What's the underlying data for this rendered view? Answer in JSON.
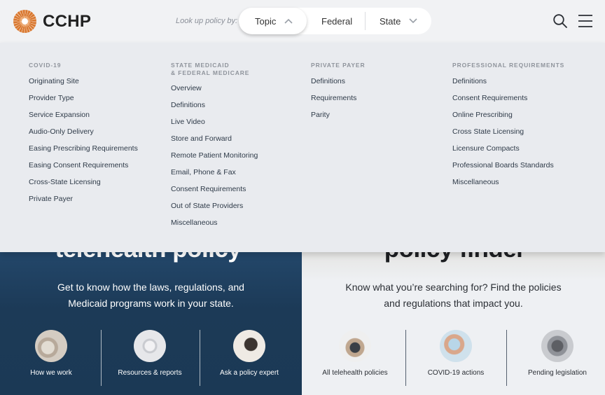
{
  "header": {
    "logo_text": "CCHP",
    "lookup_label": "Look up policy by:",
    "toggle": {
      "topic": "Topic",
      "federal": "Federal",
      "state": "State"
    }
  },
  "dropdown": {
    "columns": [
      {
        "heading": [
          "COVID-19"
        ],
        "links": [
          "Originating Site",
          "Provider Type",
          "Service Expansion",
          "Audio-Only Delivery",
          "Easing Prescribing Requirements",
          "Easing Consent Requirements",
          "Cross-State Licensing",
          "Private Payer"
        ]
      },
      {
        "heading": [
          "STATE MEDICAID",
          "& FEDERAL MEDICARE"
        ],
        "links": [
          "Overview",
          "Definitions",
          "Live Video",
          "Store and Forward",
          "Remote Patient Monitoring",
          "Email, Phone & Fax",
          "Consent Requirements",
          "Out of State Providers",
          "Miscellaneous"
        ]
      },
      {
        "heading": [
          "PRIVATE PAYER"
        ],
        "links": [
          "Definitions",
          "Requirements",
          "Parity"
        ]
      },
      {
        "heading": [
          "PROFESSIONAL REQUIREMENTS"
        ],
        "links": [
          "Definitions",
          "Consent Requirements",
          "Online Prescribing",
          "Cross State Licensing",
          "Licensure Compacts",
          "Professional Boards Standards",
          "Miscellaneous"
        ]
      }
    ]
  },
  "hero_left": {
    "title": "telehealth policy",
    "desc": [
      "Get to know how the laws, regulations, and",
      "Medicaid programs work in your state."
    ],
    "tiles": [
      "How we work",
      "Resources & reports",
      "Ask a policy expert"
    ]
  },
  "hero_right": {
    "title": "policy finder",
    "desc": [
      "Know what you’re searching for? Find the policies",
      "and regulations that impact you."
    ],
    "tiles": [
      "All telehealth policies",
      "COVID-19 actions",
      "Pending legislation"
    ]
  }
}
